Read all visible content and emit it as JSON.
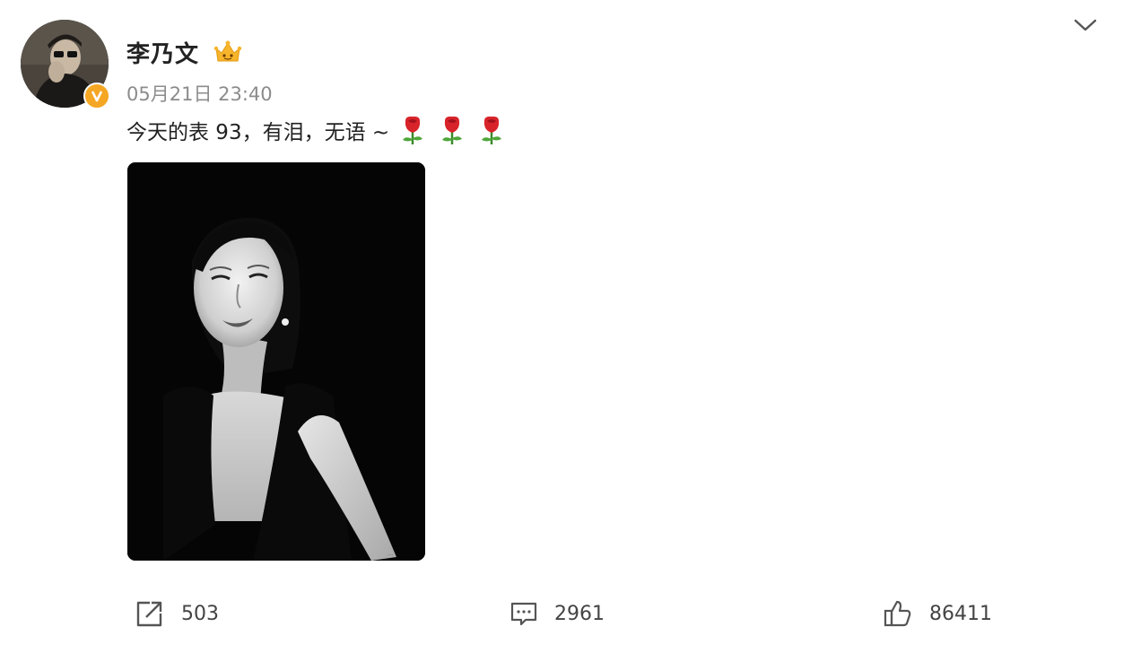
{
  "post": {
    "author": {
      "name": "李乃文",
      "verified": true,
      "badge_color": "#f5a623"
    },
    "timestamp": "05月21日 23:40",
    "text": "今天的表 93，有泪，无语 ~",
    "emoji": [
      "rose-emoji",
      "rose-emoji",
      "rose-emoji"
    ],
    "image": {
      "description": "black-and-white portrait photo"
    },
    "actions": {
      "repost_count": "503",
      "comment_count": "2961",
      "like_count": "86411"
    }
  },
  "colors": {
    "text_primary": "#222222",
    "text_secondary": "#8c8c8c",
    "icon_gray": "#666666"
  }
}
